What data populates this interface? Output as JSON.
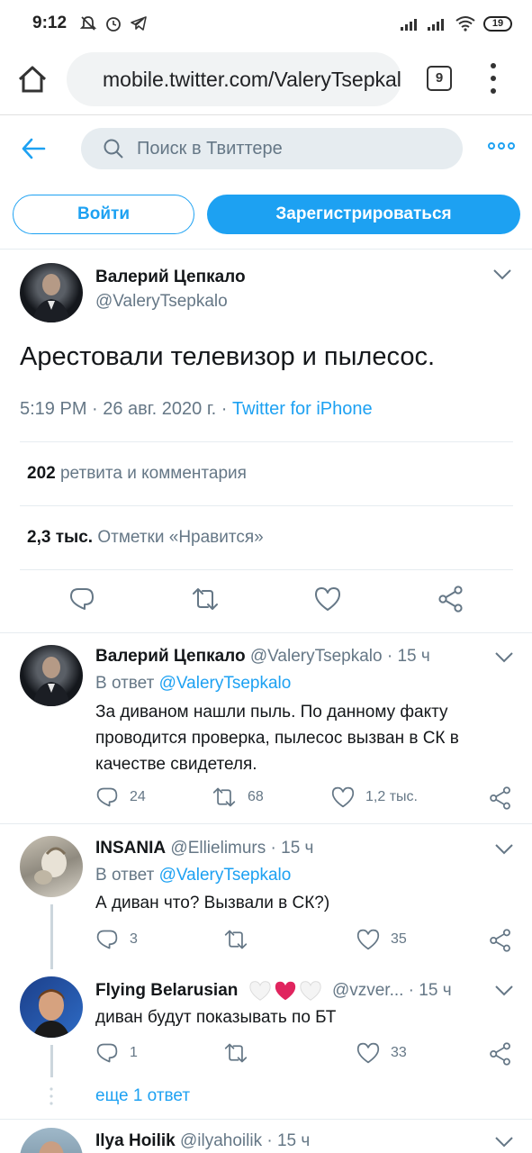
{
  "status_bar": {
    "time": "9:12",
    "battery": "19"
  },
  "browser": {
    "url": "mobile.twitter.com/ValeryTsepkalo",
    "tab_count": "9"
  },
  "twitter_header": {
    "search_placeholder": "Поиск в Твиттере"
  },
  "auth": {
    "login_label": "Войти",
    "signup_label": "Зарегистрироваться"
  },
  "main_tweet": {
    "name": "Валерий Цепкало",
    "handle": "@ValeryTsepkalo",
    "text": "Арестовали телевизор и пылесос.",
    "time": "5:19 PM · 26 авг. 2020 г. · ",
    "source": "Twitter for iPhone",
    "retweets_count": "202",
    "retweets_label": "ретвита и комментария",
    "likes_count": "2,3 тыс.",
    "likes_label": "Отметки «Нравится»"
  },
  "replies": [
    {
      "name": "Валерий Цепкало",
      "handle": "@ValeryTsepkalo · 15 ч",
      "reply_prefix": "В ответ ",
      "reply_to": "@ValeryTsepkalo",
      "text": "За диваном нашли пыль. По данному факту проводится проверка, пылесос вызван в СК в качестве свидетеля.",
      "replies": "24",
      "retweets": "68",
      "likes": "1,2 тыс."
    },
    {
      "name": "INSANIA",
      "handle": "@Ellielimurs · 15 ч",
      "reply_prefix": "В ответ ",
      "reply_to": "@ValeryTsepkalo",
      "text": "А диван что? Вызвали в СК?)",
      "replies": "3",
      "retweets": "",
      "likes": "35"
    },
    {
      "name": "Flying Belarusian",
      "handle": "@vzver... · 15 ч",
      "text": "диван будут показывать по БТ",
      "replies": "1",
      "retweets": "",
      "likes": "33"
    },
    {
      "name": "Ilya Hoilik",
      "handle": "@ilyahoilik · 15 ч"
    }
  ],
  "more_replies": "еще 1 ответ",
  "colors": {
    "accent": "#1da1f2",
    "secondary_text": "#657786",
    "like_heart": "#e0245e"
  }
}
